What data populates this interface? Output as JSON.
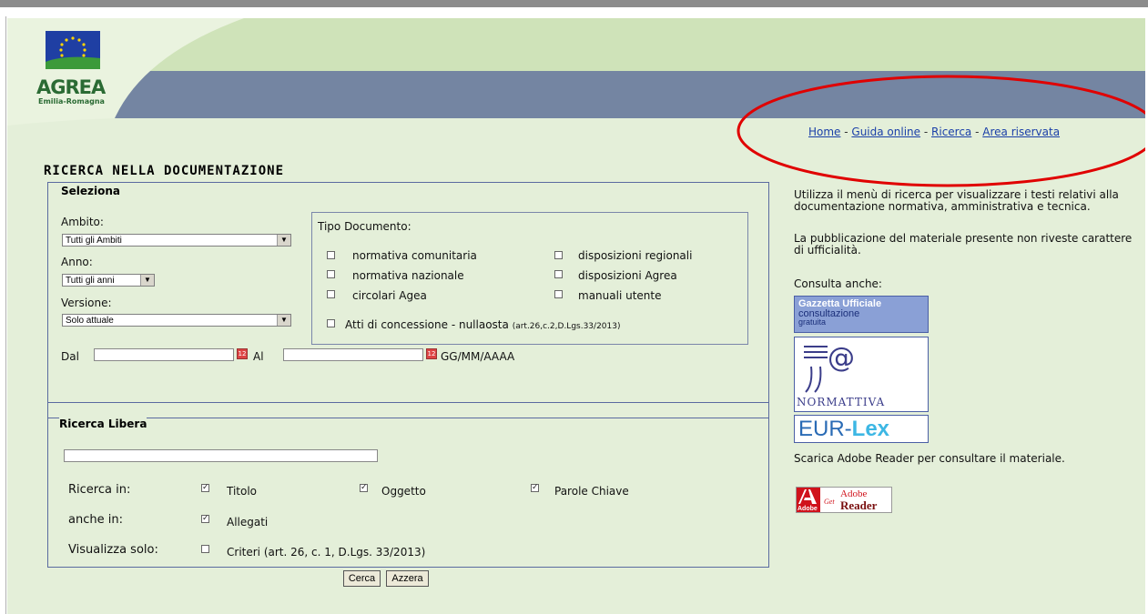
{
  "header": {
    "logo_text": "AGREA",
    "logo_sub": "Emilia-Romagna"
  },
  "nav": {
    "items": [
      "Home",
      "Guida online",
      "Ricerca",
      "Area riservata"
    ],
    "separator": " - "
  },
  "page_title": "RICERCA NELLA DOCUMENTAZIONE",
  "seleziona": {
    "legend": "Seleziona",
    "ambito_label": "Ambito:",
    "ambito_value": "Tutti gli Ambiti",
    "anno_label": "Anno:",
    "anno_value": "Tutti gli anni",
    "versione_label": "Versione:",
    "versione_value": "Solo attuale",
    "tipo_label": "Tipo Documento:",
    "tipo_items": [
      "normativa comunitaria",
      "normativa nazionale",
      "circolari Agea",
      "disposizioni regionali",
      "disposizioni Agrea",
      "manuali utente"
    ],
    "atti_label": "Atti di concessione - nullaosta",
    "atti_note": "(art.26,c.2,D.Lgs.33/2013)",
    "dal_label": "Dal",
    "al_label": "Al",
    "date_format": "GG/MM/AAAA"
  },
  "ricerca_libera": {
    "legend": "Ricerca Libera",
    "ricerca_in_label": "Ricerca in:",
    "titolo": "Titolo",
    "oggetto": "Oggetto",
    "parole": "Parole Chiave",
    "anche_in_label": "anche in:",
    "allegati": "Allegati",
    "visualizza_label": "Visualizza solo:",
    "criteri": "Criteri (art. 26, c. 1, D.Lgs. 33/2013)"
  },
  "buttons": {
    "cerca": "Cerca",
    "azzera": "Azzera"
  },
  "sidebar": {
    "intro_1": "Utilizza il menù di ricerca per visualizzare i testi relativi alla documentazione normativa, amministrativa e tecnica.",
    "intro_2": "La pubblicazione del materiale presente non riveste carattere di ufficialità.",
    "consulta": "Consulta anche:",
    "gazzetta_title": "Gazzetta Ufficiale",
    "gazzetta_sub1": "consultazione",
    "gazzetta_sub2": "gratuita",
    "normattiva": "NORMATTIVA",
    "eurlex_a": "EUR-",
    "eurlex_b": "Lex",
    "scarica": "Scarica Adobe Reader per consultare il materiale.",
    "adobe_get": "Get",
    "adobe_brand": "Adobe",
    "adobe_reader": "Reader",
    "adobe_small": "Adobe"
  },
  "colors": {
    "page_bg": "#e4efd9",
    "header_blue": "#7485a2",
    "link": "#1a3fa8",
    "ellipse": "#e00000"
  }
}
